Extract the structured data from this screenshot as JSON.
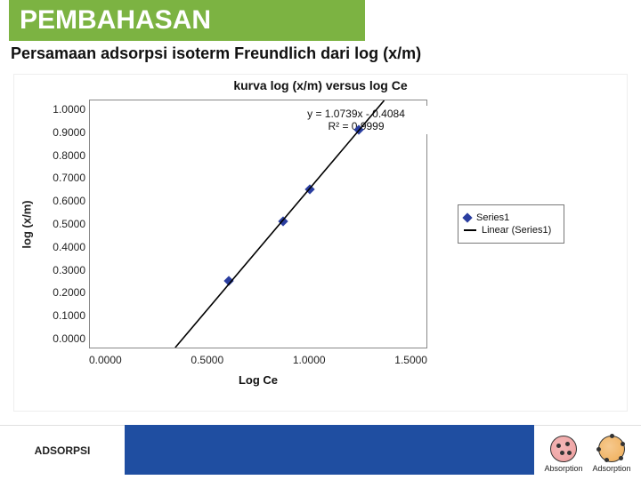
{
  "header": {
    "title": "PEMBAHASAN",
    "subtitle": "Persamaan adsorpsi isoterm Freundlich dari log (x/m)"
  },
  "chart_data": {
    "type": "scatter",
    "title": "kurva log (x/m) versus log Ce",
    "xlabel": "Log Ce",
    "ylabel": "log (x/m)",
    "xticks": [
      "0.0000",
      "0.5000",
      "1.0000",
      "1.5000"
    ],
    "yticks": [
      "1.0000",
      "0.9000",
      "0.8000",
      "0.7000",
      "0.6000",
      "0.5000",
      "0.4000",
      "0.3000",
      "0.2000",
      "0.1000",
      "0.0000"
    ],
    "xlim": [
      0,
      1.5
    ],
    "ylim": [
      0,
      1.0
    ],
    "series": [
      {
        "name": "Series1",
        "kind": "scatter",
        "x": [
          0.62,
          0.86,
          0.98,
          1.2
        ],
        "y": [
          0.27,
          0.51,
          0.64,
          0.88
        ]
      },
      {
        "name": "Linear (Series1)",
        "kind": "line",
        "slope": 1.0739,
        "intercept": -0.4084
      }
    ],
    "legend": [
      "Series1",
      "Linear (Series1)"
    ],
    "annotation": {
      "equation": "y = 1.0739x - 0.4084",
      "r2": "R² = 0.9999"
    }
  },
  "footer": {
    "left_label": "ADSORPSI",
    "icons": [
      {
        "label": "Absorption"
      },
      {
        "label": "Adsorption"
      }
    ]
  }
}
